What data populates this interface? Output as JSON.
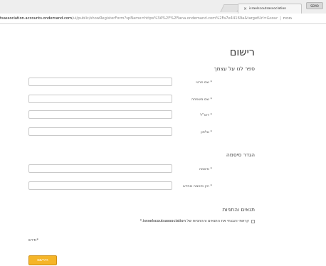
{
  "browser": {
    "tab_title": "israelscoutsassociation",
    "tab_close": "×",
    "profile_badge": "SEMO",
    "url_host": "tsassociation.accounts.ondemand.com",
    "url_path": "/ui/public/showRegisterForm?spName=https%3A%2F%2Fiana.ondemand.com%2Fa7e44169a&targetUrl=&sour",
    "url_end": "בוכות"
  },
  "form": {
    "title": "רישום",
    "about_section": "ספר לנו על עצמך",
    "fields": [
      {
        "label": "שם פרטי",
        "required_mark": "*",
        "value": ""
      },
      {
        "label": "שם משפחה",
        "required_mark": "*",
        "value": ""
      },
      {
        "label": "דוא\"ל",
        "required_mark": "*",
        "value": ""
      },
      {
        "label": "טלפון",
        "required_mark": "*",
        "value": ""
      }
    ],
    "password_section": "הגדר סיסמה",
    "password_fields": [
      {
        "label": "סיסמה",
        "required_mark": "*",
        "value": ""
      },
      {
        "label": "הזן סיסמה מחדש",
        "required_mark": "*",
        "value": ""
      }
    ],
    "terms_section": "תנאים והתניות",
    "terms_text": "קראתי והבנתי את התנאים וההתניות של",
    "terms_link": "israelscoutsassociation.",
    "terms_star": "*",
    "terms_checked": false,
    "required_note": "*נדרש",
    "submit_label": "הירשם"
  }
}
